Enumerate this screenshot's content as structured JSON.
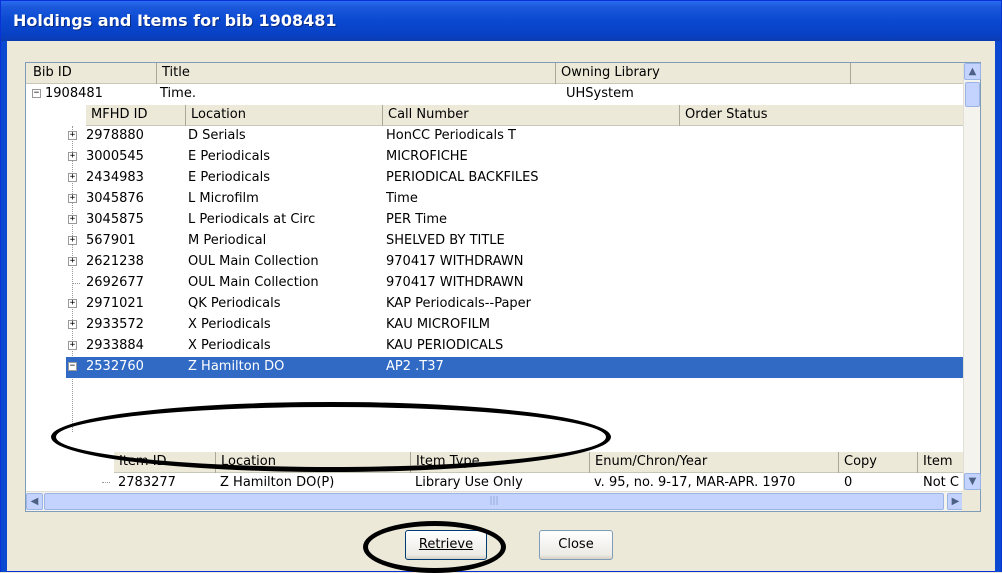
{
  "window": {
    "title": "Holdings and Items for bib 1908481"
  },
  "bib_header": {
    "bib_id": "Bib ID",
    "title": "Title",
    "owning_library": "Owning Library"
  },
  "bib": {
    "id": "1908481",
    "title": "Time.",
    "owning_library": "UHSystem"
  },
  "holdings_header": {
    "mfhd_id": "MFHD ID",
    "location": "Location",
    "call_number": "Call Number",
    "order_status": "Order Status"
  },
  "holdings": [
    {
      "id": "2978880",
      "location": "D Serials",
      "call_number": "HonCC Periodicals T",
      "expander": "+"
    },
    {
      "id": "3000545",
      "location": "E Periodicals",
      "call_number": "MICROFICHE",
      "expander": "+"
    },
    {
      "id": "2434983",
      "location": "E Periodicals",
      "call_number": "PERIODICAL BACKFILES",
      "expander": "+"
    },
    {
      "id": "3045876",
      "location": "L Microfilm",
      "call_number": "Time",
      "expander": "+"
    },
    {
      "id": "3045875",
      "location": "L Periodicals at Circ",
      "call_number": "PER Time",
      "expander": "+"
    },
    {
      "id": "567901",
      "location": "M Periodical",
      "call_number": "SHELVED BY TITLE",
      "expander": "+"
    },
    {
      "id": "2621238",
      "location": "OUL Main Collection",
      "call_number": "970417 WITHDRAWN",
      "expander": "+"
    },
    {
      "id": "2692677",
      "location": "OUL Main Collection",
      "call_number": "970417 WITHDRAWN",
      "expander": ""
    },
    {
      "id": "2971021",
      "location": "QK Periodicals",
      "call_number": "KAP Periodicals--Paper",
      "expander": "+"
    },
    {
      "id": "2933572",
      "location": "X Periodicals",
      "call_number": "KAU MICROFILM",
      "expander": "+"
    },
    {
      "id": "2933884",
      "location": "X Periodicals",
      "call_number": "KAU PERIODICALS",
      "expander": "+"
    },
    {
      "id": "2532760",
      "location": "Z Hamilton DO",
      "call_number": "AP2 .T37",
      "expander": "−",
      "selected": true
    }
  ],
  "items_header": {
    "item_id": "Item ID",
    "location": "Location",
    "item_type": "Item Type",
    "enum": "Enum/Chron/Year",
    "copy": "Copy",
    "item_status": "Item"
  },
  "items": [
    {
      "id": "2783277",
      "location": "Z Hamilton DO(P)",
      "item_type": "Library Use Only",
      "enum": "v. 95, no. 9-17, MAR-APR. 1970",
      "copy": "0",
      "status": "Not C"
    }
  ],
  "buttons": {
    "retrieve": "Retrieve",
    "close": "Close"
  },
  "colors": {
    "selection": "#316ac5",
    "title_bar": "#0a49d0",
    "annotation": "#000000"
  }
}
